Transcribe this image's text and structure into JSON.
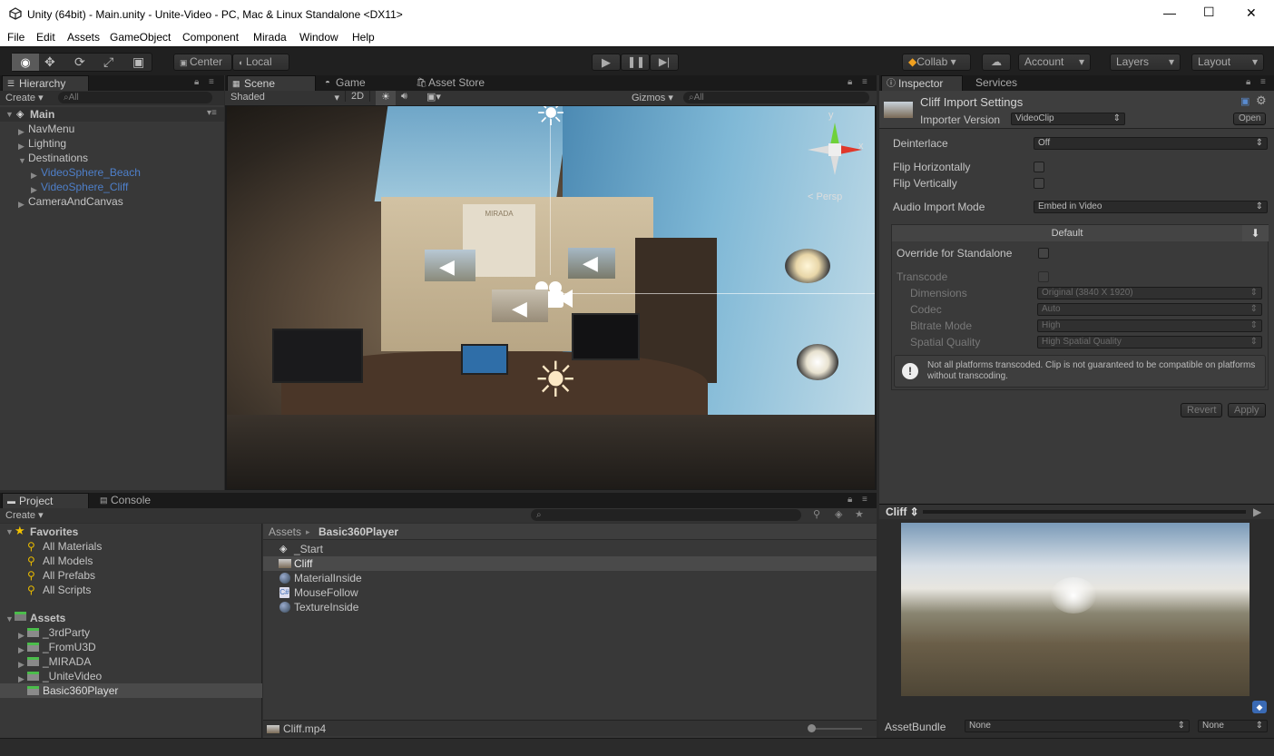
{
  "window": {
    "title": "Unity (64bit) - Main.unity - Unite-Video - PC, Mac & Linux Standalone <DX11>",
    "min": "—",
    "max": "☐",
    "close": "✕"
  },
  "menu": [
    "File",
    "Edit",
    "Assets",
    "GameObject",
    "Component",
    "Mirada",
    "Window",
    "Help"
  ],
  "toolbar": {
    "center": "Center",
    "local": "Local",
    "collab": "Collab",
    "account": "Account",
    "layers": "Layers",
    "layout": "Layout"
  },
  "hierarchy": {
    "tab": "Hierarchy",
    "create": "Create",
    "search_placeholder": "All",
    "scene": "Main",
    "items": [
      {
        "label": "NavMenu"
      },
      {
        "label": "Lighting"
      },
      {
        "label": "Destinations"
      },
      {
        "label": "VideoSphere_Beach"
      },
      {
        "label": "VideoSphere_Cliff"
      },
      {
        "label": "CameraAndCanvas"
      }
    ]
  },
  "scene": {
    "tabs": [
      "Scene",
      "Game",
      "Asset Store"
    ],
    "shading": "Shaded",
    "mode2d": "2D",
    "gizmos": "Gizmos",
    "search_placeholder": "All",
    "persp": "Persp",
    "axis_y": "y",
    "axis_x": "x",
    "poster_text": "MIRADA"
  },
  "inspector": {
    "tabs": [
      "Inspector",
      "Services"
    ],
    "title": "Cliff Import Settings",
    "importer_label": "Importer Version",
    "importer_value": "VideoClip",
    "open": "Open",
    "deinterlace_label": "Deinterlace",
    "deinterlace_value": "Off",
    "flip_h": "Flip Horizontally",
    "flip_v": "Flip Vertically",
    "audio_label": "Audio Import Mode",
    "audio_value": "Embed in Video",
    "platform_default": "Default",
    "override": "Override for Standalone",
    "transcode": "Transcode",
    "dimensions_label": "Dimensions",
    "dimensions_value": "Original (3840 X 1920)",
    "codec_label": "Codec",
    "codec_value": "Auto",
    "bitrate_label": "Bitrate Mode",
    "bitrate_value": "High",
    "spatial_label": "Spatial Quality",
    "spatial_value": "High Spatial Quality",
    "warning": "Not all platforms transcoded. Clip is not guaranteed to be compatible on platforms without transcoding.",
    "revert": "Revert",
    "apply": "Apply",
    "preview_name": "Cliff",
    "assetbundle_label": "AssetBundle",
    "assetbundle_value": "None",
    "assetbundle_variant": "None"
  },
  "project": {
    "tabs": [
      "Project",
      "Console"
    ],
    "create": "Create",
    "favorites": "Favorites",
    "favorite_items": [
      "All Materials",
      "All Models",
      "All Prefabs",
      "All Scripts"
    ],
    "assets": "Assets",
    "asset_folders": [
      "_3rdParty",
      "_FromU3D",
      "_MIRADA",
      "_UniteVideo",
      "Basic360Player"
    ],
    "breadcrumb_root": "Assets",
    "breadcrumb_sep": "▸",
    "breadcrumb_current": "Basic360Player",
    "files": [
      "_Start",
      "Cliff",
      "MaterialInside",
      "MouseFollow",
      "TextureInside"
    ],
    "footer_file": "Cliff.mp4"
  },
  "colors": {
    "accent_blue": "#3e6ea8",
    "selection": "#3a5d8f",
    "panel": "#383838"
  }
}
